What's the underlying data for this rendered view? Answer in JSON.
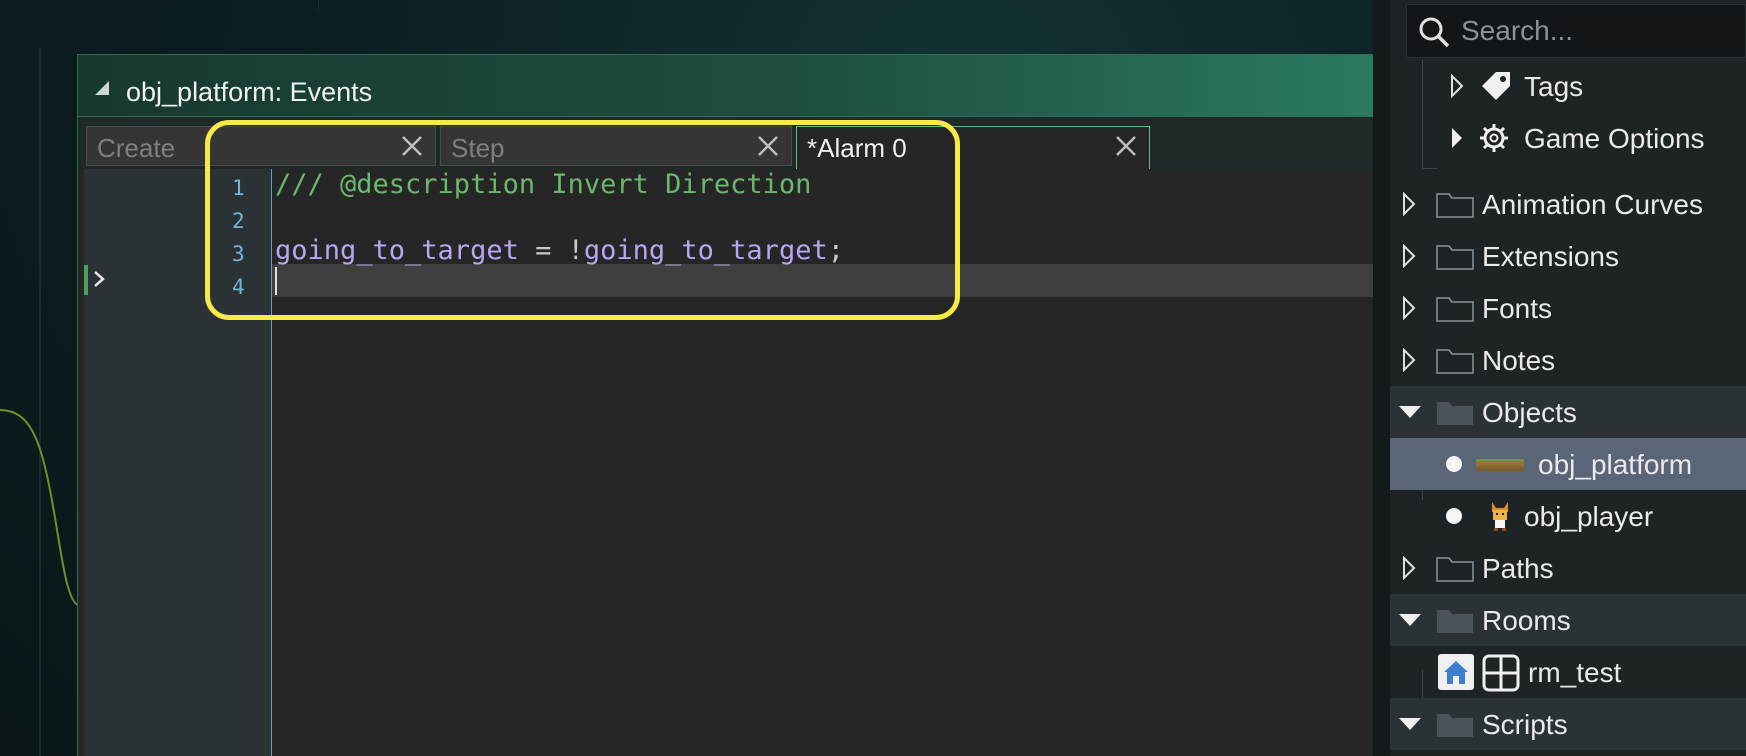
{
  "window": {
    "title": "obj_platform: Events"
  },
  "tabs": [
    {
      "label": "Create",
      "active": false
    },
    {
      "label": "Step",
      "active": false
    },
    {
      "label": "*Alarm 0",
      "active": true
    }
  ],
  "editor": {
    "line_numbers": [
      "1",
      "2",
      "3",
      "4"
    ],
    "lines": {
      "l1_comment": "/// @description Invert Direction",
      "l3_lhs": "going_to_target",
      "l3_op": " = !",
      "l3_rhs": "going_to_target",
      "l3_end": ";"
    }
  },
  "asset_browser": {
    "search_placeholder": "Search...",
    "items": {
      "tags": "Tags",
      "game_options": "Game Options",
      "animation_curves": "Animation Curves",
      "extensions": "Extensions",
      "fonts": "Fonts",
      "notes": "Notes",
      "objects": "Objects",
      "obj_platform": "obj_platform",
      "obj_player": "obj_player",
      "paths": "Paths",
      "rooms": "Rooms",
      "rm_test": "rm_test",
      "scripts": "Scripts"
    }
  },
  "colors": {
    "highlight": "#f7ea47",
    "comment": "#6ab86b",
    "identifier": "#b7a6f2",
    "selected_row": "#5a6578"
  }
}
